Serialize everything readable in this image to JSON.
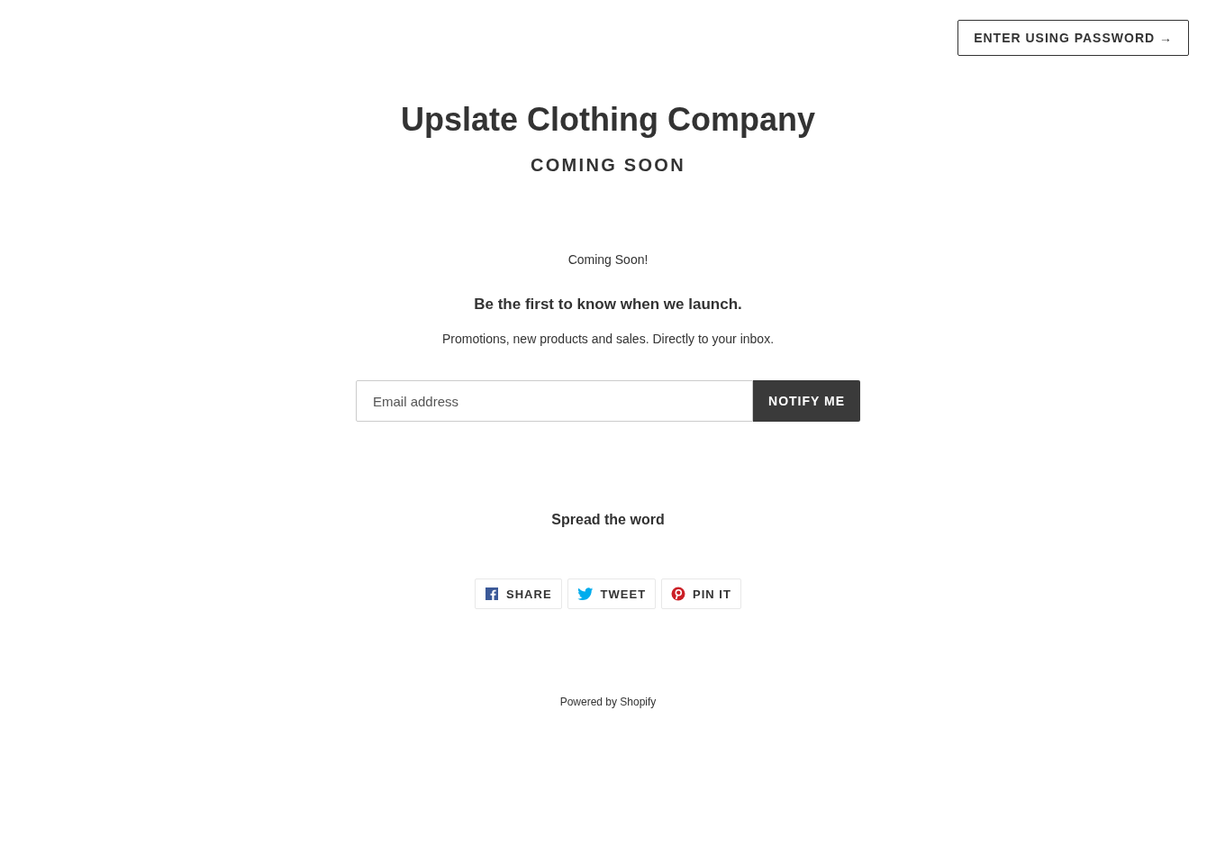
{
  "header": {
    "password_button": "ENTER USING PASSWORD →"
  },
  "store": {
    "title": "Upslate Clothing Company",
    "subtitle": "COMING SOON"
  },
  "message": "Coming Soon!",
  "signup": {
    "heading": "Be the first to know when we launch.",
    "text": "Promotions, new products and sales. Directly to your inbox.",
    "email": {
      "placeholder": "Email address"
    },
    "button": "NOTIFY ME"
  },
  "share": {
    "heading": "Spread the word",
    "buttons": [
      {
        "kind": "facebook",
        "label": "SHARE"
      },
      {
        "kind": "twitter",
        "label": "TWEET"
      },
      {
        "kind": "pinterest",
        "label": "PIN IT"
      }
    ]
  },
  "footer": "Powered by Shopify"
}
